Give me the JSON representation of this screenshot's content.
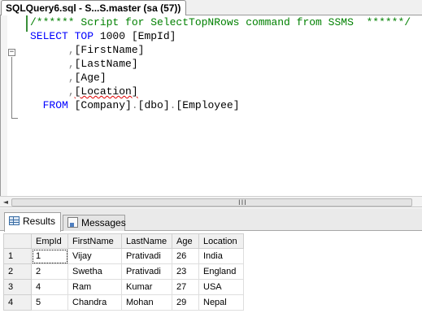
{
  "tab": {
    "title": "SQLQuery6.sql - S...S.master (sa (57))"
  },
  "editor": {
    "lines": [
      [
        {
          "cls": "cmt",
          "t": "/****** Script for SelectTopNRows command from SSMS  ******/"
        }
      ],
      [
        {
          "cls": "kw",
          "t": "SELECT"
        },
        {
          "cls": "id",
          "t": " "
        },
        {
          "cls": "kw",
          "t": "TOP"
        },
        {
          "cls": "id",
          "t": " 1000 [EmpId]"
        }
      ],
      [
        {
          "cls": "id",
          "t": "      "
        },
        {
          "cls": "op",
          "t": ","
        },
        {
          "cls": "id",
          "t": "[FirstName]"
        }
      ],
      [
        {
          "cls": "id",
          "t": "      "
        },
        {
          "cls": "op",
          "t": ","
        },
        {
          "cls": "id",
          "t": "[LastName]"
        }
      ],
      [
        {
          "cls": "id",
          "t": "      "
        },
        {
          "cls": "op",
          "t": ","
        },
        {
          "cls": "id",
          "t": "[Age]"
        }
      ],
      [
        {
          "cls": "id",
          "t": "      "
        },
        {
          "cls": "op",
          "t": ","
        },
        {
          "cls": "id squiggle",
          "t": "[Location]"
        }
      ],
      [
        {
          "cls": "id",
          "t": "  "
        },
        {
          "cls": "kw",
          "t": "FROM"
        },
        {
          "cls": "id",
          "t": " [Company]"
        },
        {
          "cls": "op",
          "t": "."
        },
        {
          "cls": "id",
          "t": "[dbo]"
        },
        {
          "cls": "op",
          "t": "."
        },
        {
          "cls": "id",
          "t": "[Employee]"
        }
      ]
    ]
  },
  "scrollbar": {
    "left_arrow": "◄",
    "grip": "III"
  },
  "results_tabs": {
    "results_label": "Results",
    "messages_label": "Messages"
  },
  "grid": {
    "columns": [
      "EmpId",
      "FirstName",
      "LastName",
      "Age",
      "Location"
    ],
    "rows": [
      {
        "num": "1",
        "cells": [
          "1",
          "Vijay",
          "Prativadi",
          "26",
          "India"
        ]
      },
      {
        "num": "2",
        "cells": [
          "2",
          "Swetha",
          "Prativadi",
          "23",
          "England"
        ]
      },
      {
        "num": "3",
        "cells": [
          "4",
          "Ram",
          "Kumar",
          "27",
          "USA"
        ]
      },
      {
        "num": "4",
        "cells": [
          "5",
          "Chandra",
          "Mohan",
          "29",
          "Nepal"
        ]
      }
    ]
  }
}
